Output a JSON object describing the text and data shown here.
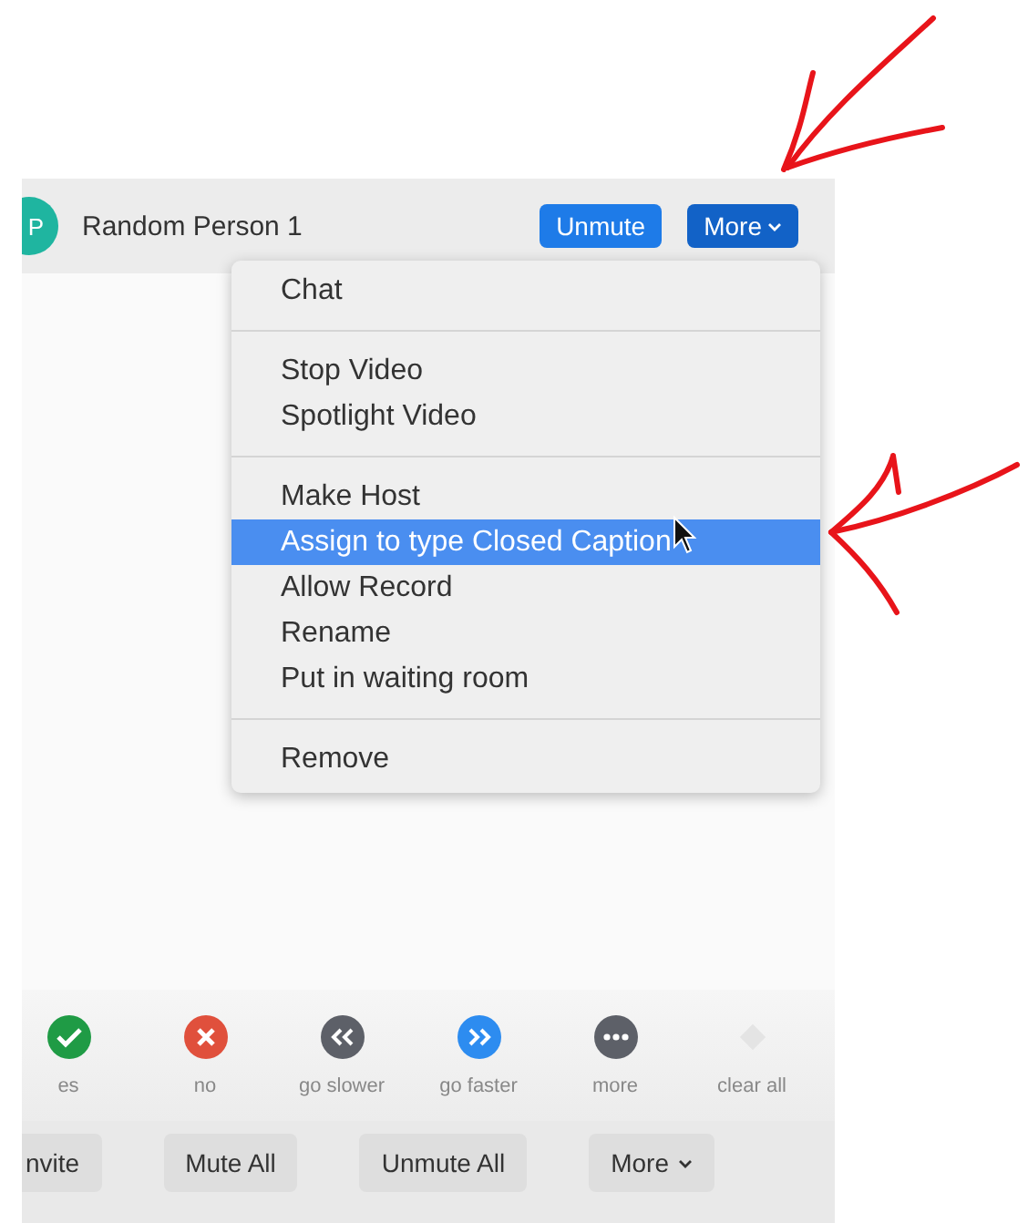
{
  "participant": {
    "avatar_initials": "P",
    "name": "Random Person 1",
    "buttons": [
      {
        "label": "Unmute",
        "caret": false,
        "pressed": false
      },
      {
        "label": "More",
        "caret": true,
        "pressed": true
      }
    ]
  },
  "menu": {
    "groups": [
      [
        {
          "label": "Chat",
          "selected": false
        }
      ],
      [
        {
          "label": "Stop Video",
          "selected": false
        },
        {
          "label": "Spotlight Video",
          "selected": false
        }
      ],
      [
        {
          "label": "Make Host",
          "selected": false
        },
        {
          "label": "Assign to type Closed Caption",
          "selected": true
        },
        {
          "label": "Allow Record",
          "selected": false
        },
        {
          "label": "Rename",
          "selected": false
        },
        {
          "label": "Put in waiting room",
          "selected": false
        }
      ],
      [
        {
          "label": "Remove",
          "selected": false
        }
      ]
    ]
  },
  "feedback": [
    {
      "label": "es",
      "kind": "yes"
    },
    {
      "label": "no",
      "kind": "no"
    },
    {
      "label": "go slower",
      "kind": "slower"
    },
    {
      "label": "go faster",
      "kind": "faster"
    },
    {
      "label": "more",
      "kind": "more"
    },
    {
      "label": "clear all",
      "kind": "clear"
    }
  ],
  "bottom_buttons": [
    {
      "label": "nvite",
      "caret": false
    },
    {
      "label": "Mute All",
      "caret": false
    },
    {
      "label": "Unmute All",
      "caret": false
    },
    {
      "label": "More",
      "caret": true
    }
  ]
}
